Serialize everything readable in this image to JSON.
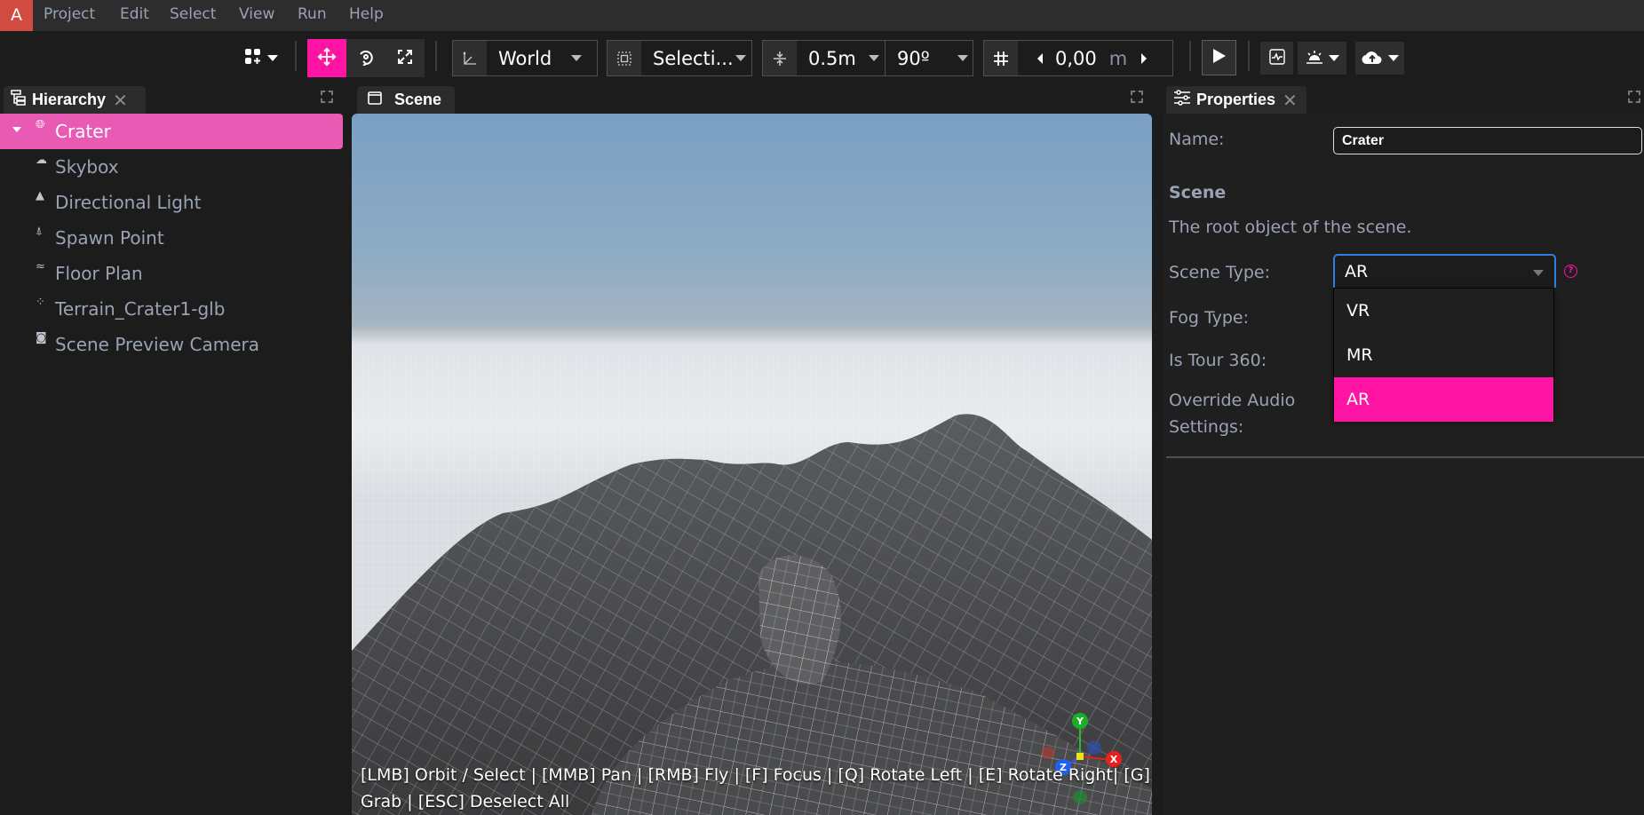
{
  "app": {
    "logo": "A"
  },
  "menu": [
    "Project",
    "Edit",
    "Select",
    "View",
    "Run",
    "Help"
  ],
  "toolbar": {
    "add_entity_icon": "grid-plus-icon",
    "transform_modes": [
      {
        "name": "translate",
        "icon": "move-arrows-icon",
        "active": true
      },
      {
        "name": "rotate",
        "icon": "rotate-icon",
        "active": false
      },
      {
        "name": "scale",
        "icon": "scale-icon",
        "active": false
      }
    ],
    "space": {
      "icon": "axes-icon",
      "value": "World"
    },
    "pivot": {
      "icon": "selection-box-icon",
      "value": "Selecti..."
    },
    "snap": {
      "icon": "snap-icon",
      "translation": "0.5m",
      "rotation": "90º"
    },
    "grid": {
      "icon": "grid-icon",
      "height": "0,00",
      "unit": "m"
    },
    "play_icon": "play-icon",
    "stats_icon": "stats-icon",
    "lighting_icon": "sunrise-icon",
    "publish_icon": "cloud-upload-icon"
  },
  "panels": {
    "hierarchy": {
      "title": "Hierarchy",
      "items": [
        {
          "label": "Crater",
          "icon": "globe-icon",
          "selected": true,
          "expanded": true
        },
        {
          "label": "Skybox",
          "icon": "cloud-icon"
        },
        {
          "label": "Directional Light",
          "icon": "triangle-icon"
        },
        {
          "label": "Spawn Point",
          "icon": "person-pin-icon"
        },
        {
          "label": "Floor Plan",
          "icon": "floor-plan-icon"
        },
        {
          "label": "Terrain_Crater1-glb",
          "icon": "model-icon"
        },
        {
          "label": "Scene Preview Camera",
          "icon": "camera-icon"
        }
      ]
    },
    "scene": {
      "title": "Scene",
      "help_text": "[LMB] Orbit / Select | [MMB] Pan | [RMB] Fly | [F] Focus | [Q] Rotate Left | [E] Rotate Right| [G] Grab | [ESC] Deselect All",
      "gizmo_axes": [
        "Y",
        "Z",
        "X"
      ]
    },
    "properties": {
      "title": "Properties",
      "name_label": "Name:",
      "name_value": "Crater",
      "section_title": "Scene",
      "section_desc": "The root object of the scene.",
      "fields": [
        {
          "label": "Scene Type:"
        },
        {
          "label": "Fog Type:"
        },
        {
          "label": "Is Tour 360:"
        },
        {
          "label": "Override Audio Settings:"
        }
      ],
      "scene_type_value": "AR",
      "scene_type_options": [
        "VR",
        "MR",
        "AR"
      ],
      "help_icon": "?"
    }
  },
  "colors": {
    "accent": "#ff14a4",
    "selection": "#e85ab4",
    "logo_bg": "#d24b40",
    "focus": "#2f7fe0"
  }
}
